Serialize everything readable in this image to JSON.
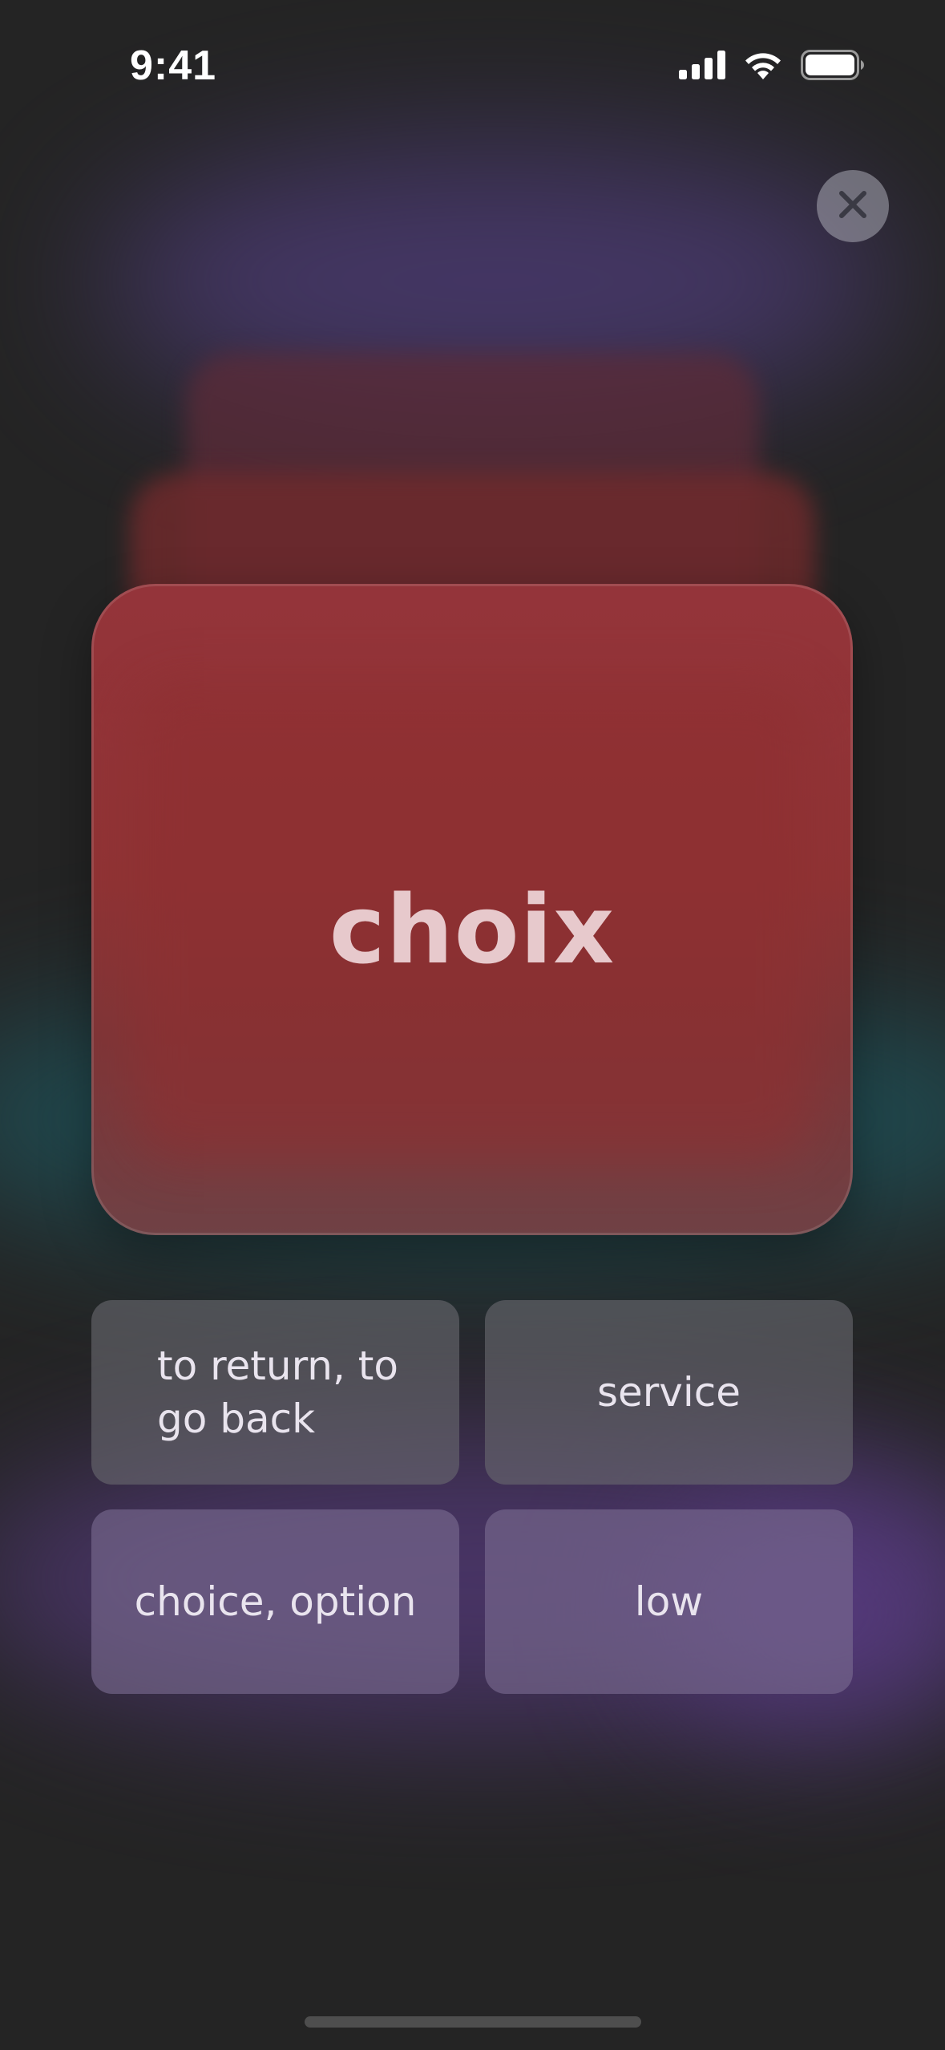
{
  "status_bar": {
    "time": "9:41",
    "icons": [
      "cellular-signal-icon",
      "wifi-icon",
      "battery-icon"
    ]
  },
  "close_button": {
    "icon": "close-icon"
  },
  "flashcard": {
    "word": "choix"
  },
  "options": [
    {
      "label": "to return, to go back"
    },
    {
      "label": "service"
    },
    {
      "label": "choice, option"
    },
    {
      "label": "low"
    }
  ],
  "colors": {
    "background": "#242424",
    "card": "#94343a",
    "card_text": "#e7c9cc",
    "option_text": "#e9e4ee",
    "glow_purple": "#4a3a70",
    "glow_teal": "#1f5158"
  }
}
